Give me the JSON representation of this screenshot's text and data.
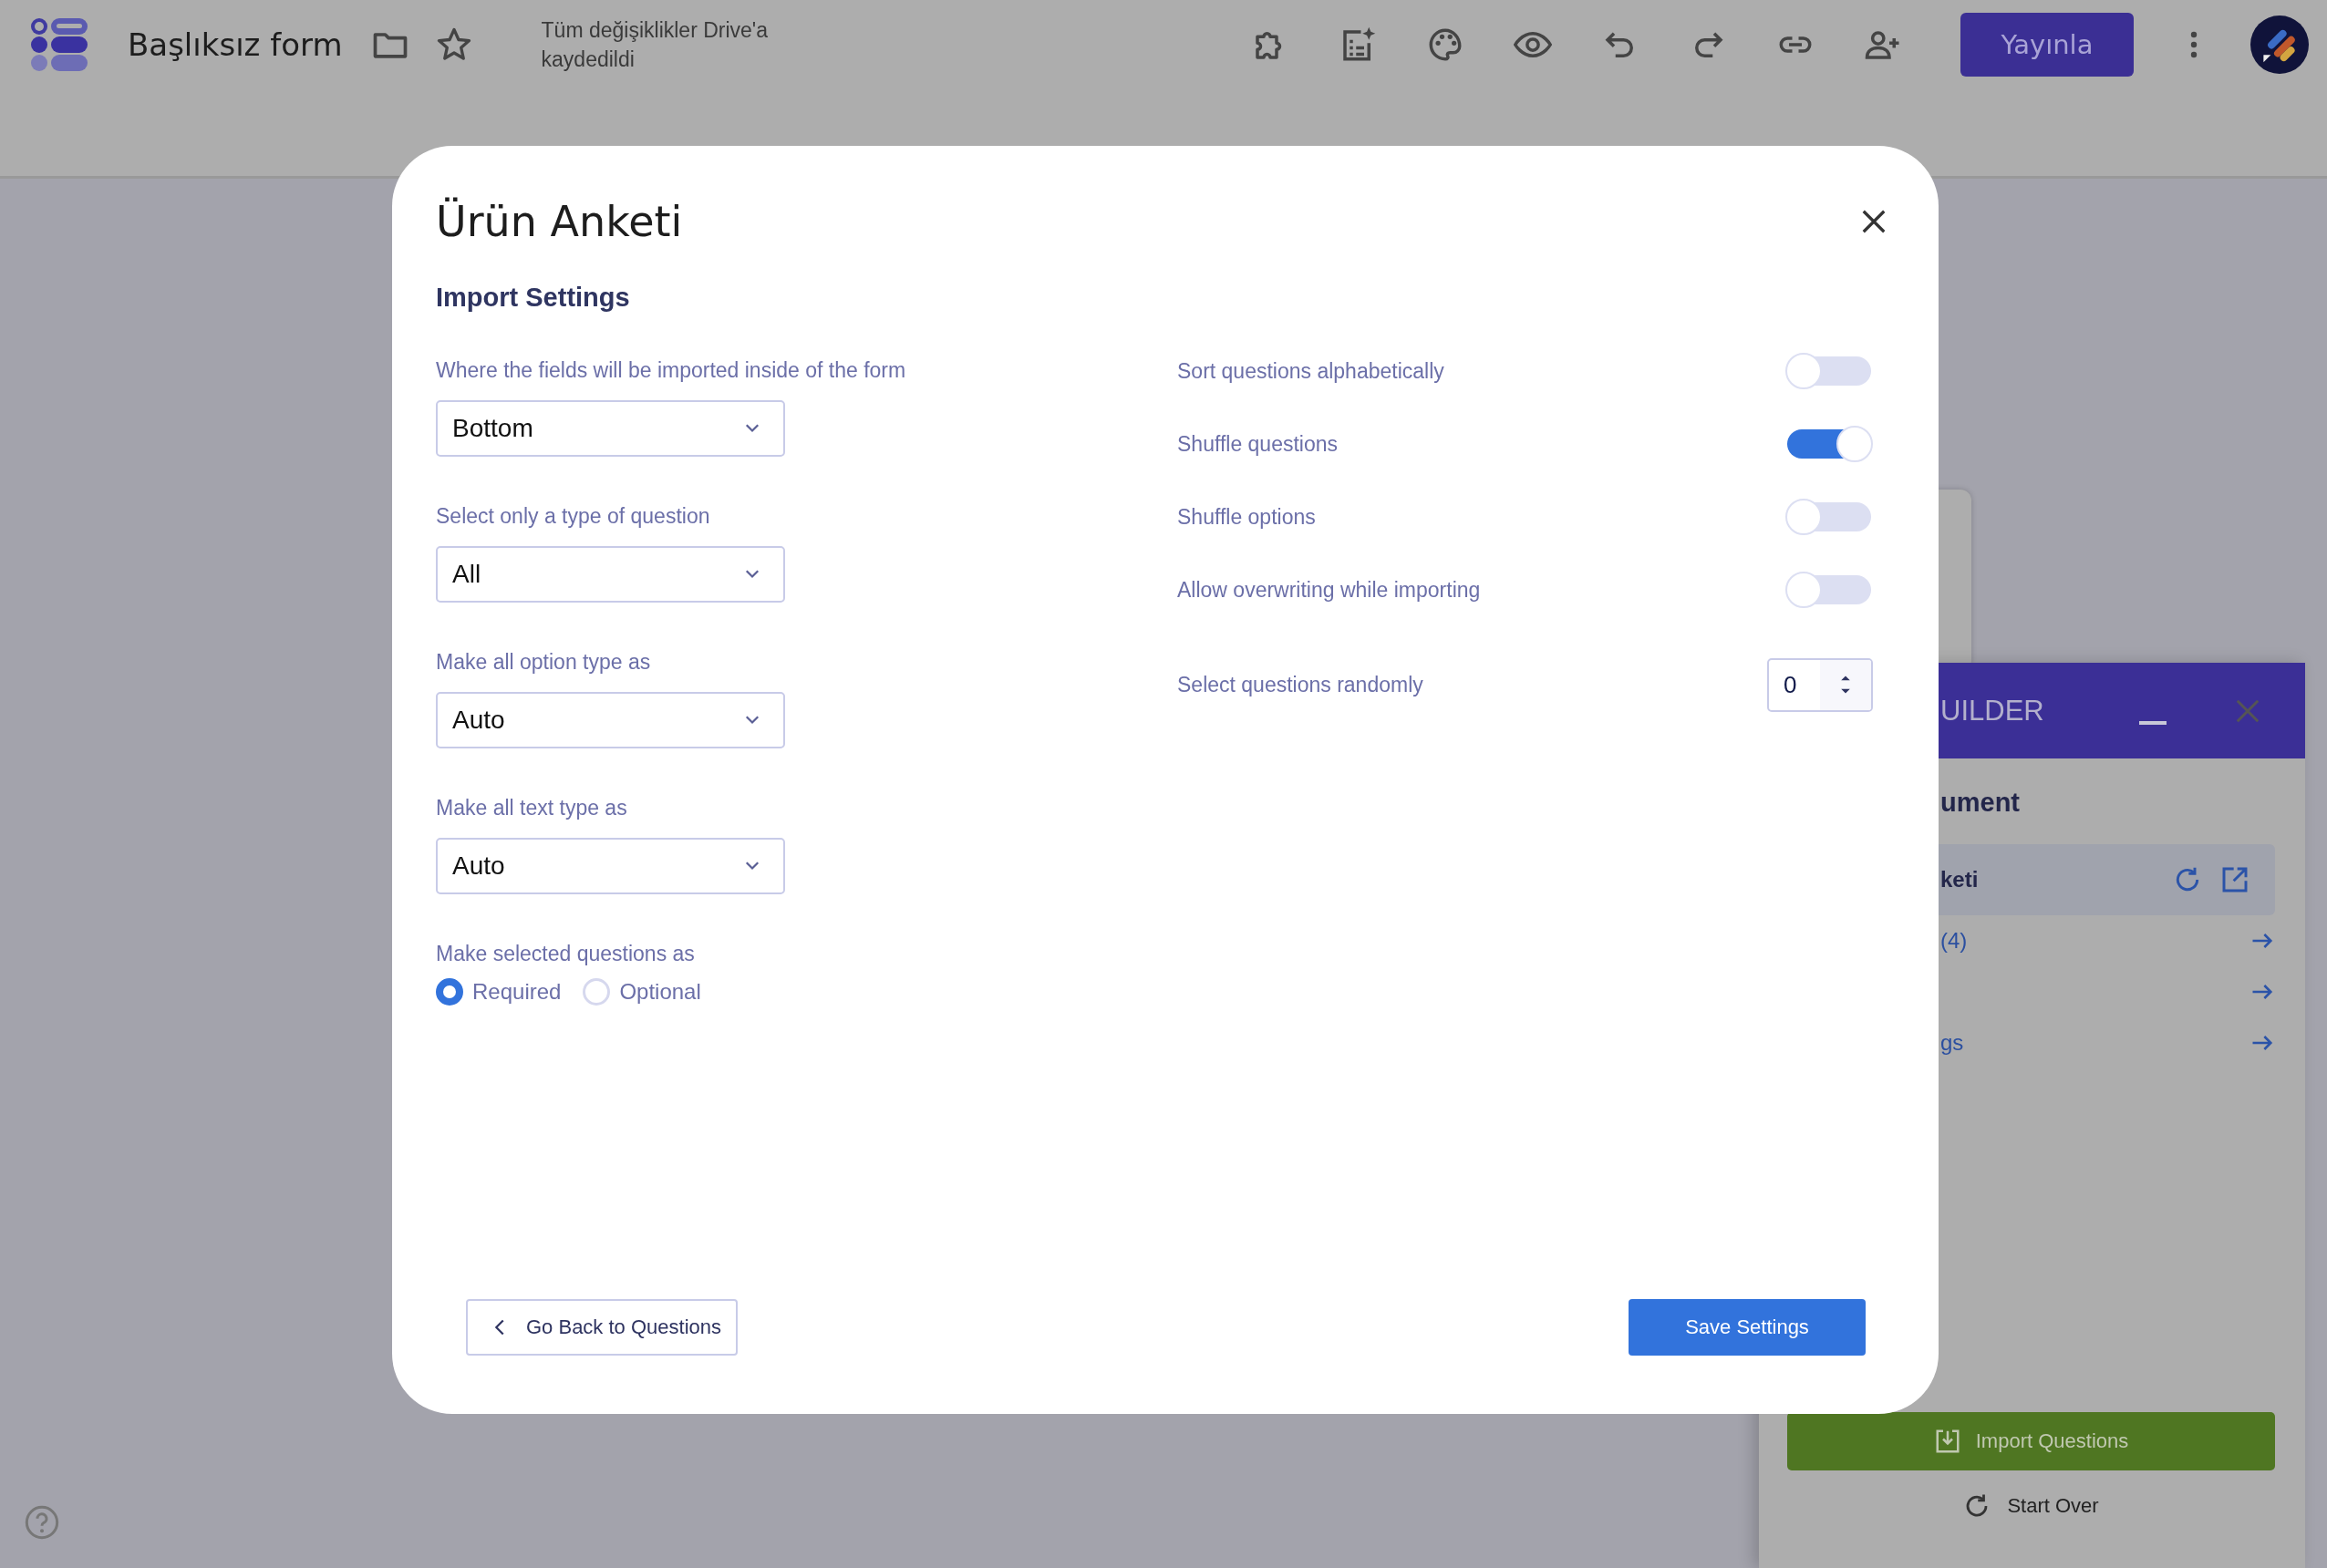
{
  "app_bar": {
    "title": "Başlıksız form",
    "save_status": "Tüm değişiklikler Drive'a kaydedildi",
    "publish_button": "Yayınla"
  },
  "modal": {
    "title": "Ürün Anketi",
    "section": "Import Settings",
    "selects": [
      {
        "label": "Where the fields will be imported inside of the form",
        "value": "Bottom"
      },
      {
        "label": "Select only a type of question",
        "value": "All"
      },
      {
        "label": "Make all option type as",
        "value": "Auto"
      },
      {
        "label": "Make all text type as",
        "value": "Auto"
      }
    ],
    "radio_group": {
      "label": "Make selected questions as",
      "options": [
        {
          "label": "Required",
          "selected": true
        },
        {
          "label": "Optional",
          "selected": false
        }
      ]
    },
    "toggles": [
      {
        "label": "Sort questions alphabetically",
        "on": false
      },
      {
        "label": "Shuffle questions",
        "on": true
      },
      {
        "label": "Shuffle options",
        "on": false
      },
      {
        "label": "Allow overwriting while importing",
        "on": false
      }
    ],
    "random_select": {
      "label": "Select questions randomly",
      "value": "0"
    },
    "back_button": "Go Back to Questions",
    "save_button": "Save Settings"
  },
  "builder_panel": {
    "title": "UILDER",
    "heading": "ument",
    "document": "keti",
    "links": [
      {
        "kind": "text",
        "label": "(4)"
      },
      {
        "kind": "bare"
      },
      {
        "kind": "text",
        "label": "gs"
      }
    ],
    "import_button": "Import Questions",
    "start_over": "Start Over"
  }
}
